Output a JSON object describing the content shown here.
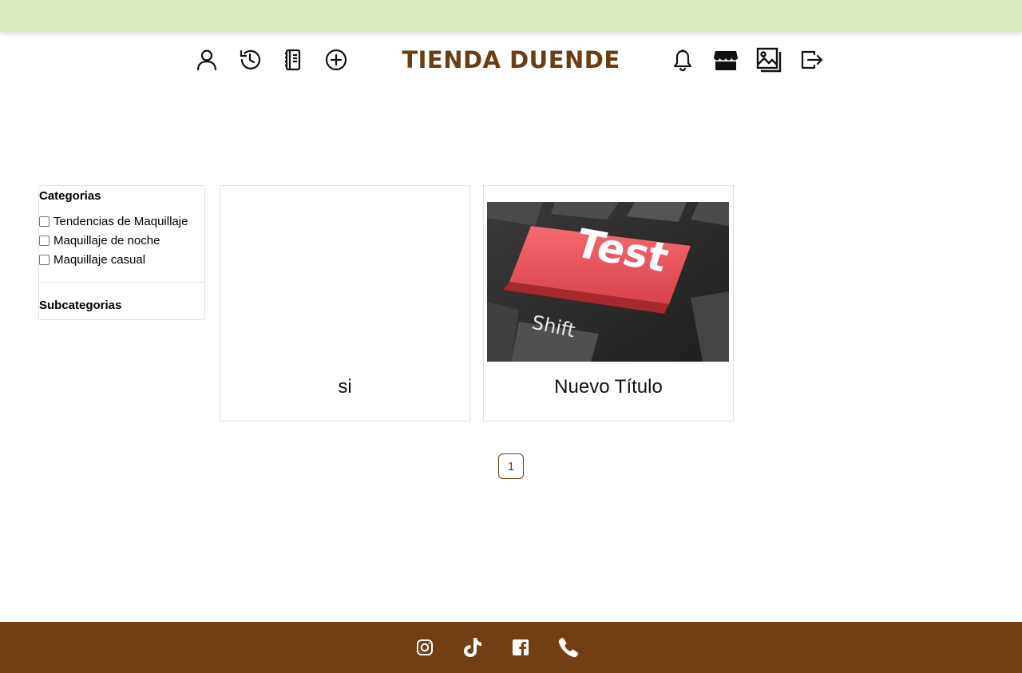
{
  "header": {
    "brand_name": "TIENDA DUENDE",
    "left_icons": [
      "user-icon",
      "history-icon",
      "journal-icon",
      "plus-circle-icon"
    ],
    "right_icons": [
      "bell-icon",
      "shop-icon",
      "images-icon",
      "logout-icon"
    ]
  },
  "filters": {
    "categories_title": "Categorias",
    "categories": [
      {
        "label": "Tendencias de Maquillaje",
        "checked": false
      },
      {
        "label": "Maquillaje de noche",
        "checked": false
      },
      {
        "label": "Maquillaje casual",
        "checked": false
      }
    ],
    "subcategories_title": "Subcategorias"
  },
  "cards": [
    {
      "title": "si",
      "has_image": false
    },
    {
      "title": "Nuevo Título",
      "has_image": true,
      "image_text_main": "Test",
      "image_text_secondary": "Shift"
    }
  ],
  "pagination": {
    "current_page": "1"
  },
  "footer": {
    "social_icons": [
      "instagram-icon",
      "tiktok-icon",
      "facebook-icon",
      "phone-icon"
    ]
  },
  "colors": {
    "top_band": "#dae9bb",
    "brand": "#6b3d12",
    "footer": "#733f12",
    "footer_icon": "#ffffff"
  }
}
